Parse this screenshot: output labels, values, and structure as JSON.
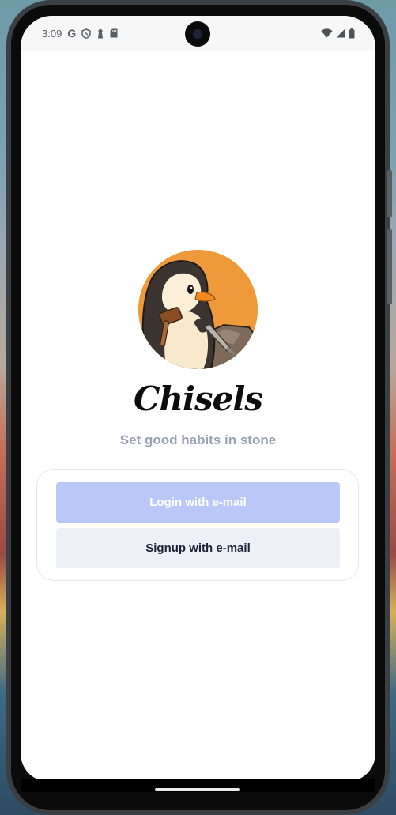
{
  "status_bar": {
    "time": "3:09",
    "left_icons": [
      "google-g-icon",
      "shield-icon",
      "keyhole-icon",
      "sd-card-icon"
    ],
    "right_icons": [
      "wifi-icon",
      "cellular-signal-icon",
      "battery-icon"
    ]
  },
  "app": {
    "title": "Chisels",
    "tagline": "Set good habits in stone",
    "logo_icon": "penguin-chiseling-stone-icon"
  },
  "auth": {
    "login_label": "Login with e-mail",
    "signup_label": "Signup with e-mail"
  },
  "colors": {
    "logo_background": "#ee9a3a",
    "login_button": "#b9c8f7",
    "signup_button": "#edf0f7",
    "tagline": "#9aa3b8"
  }
}
